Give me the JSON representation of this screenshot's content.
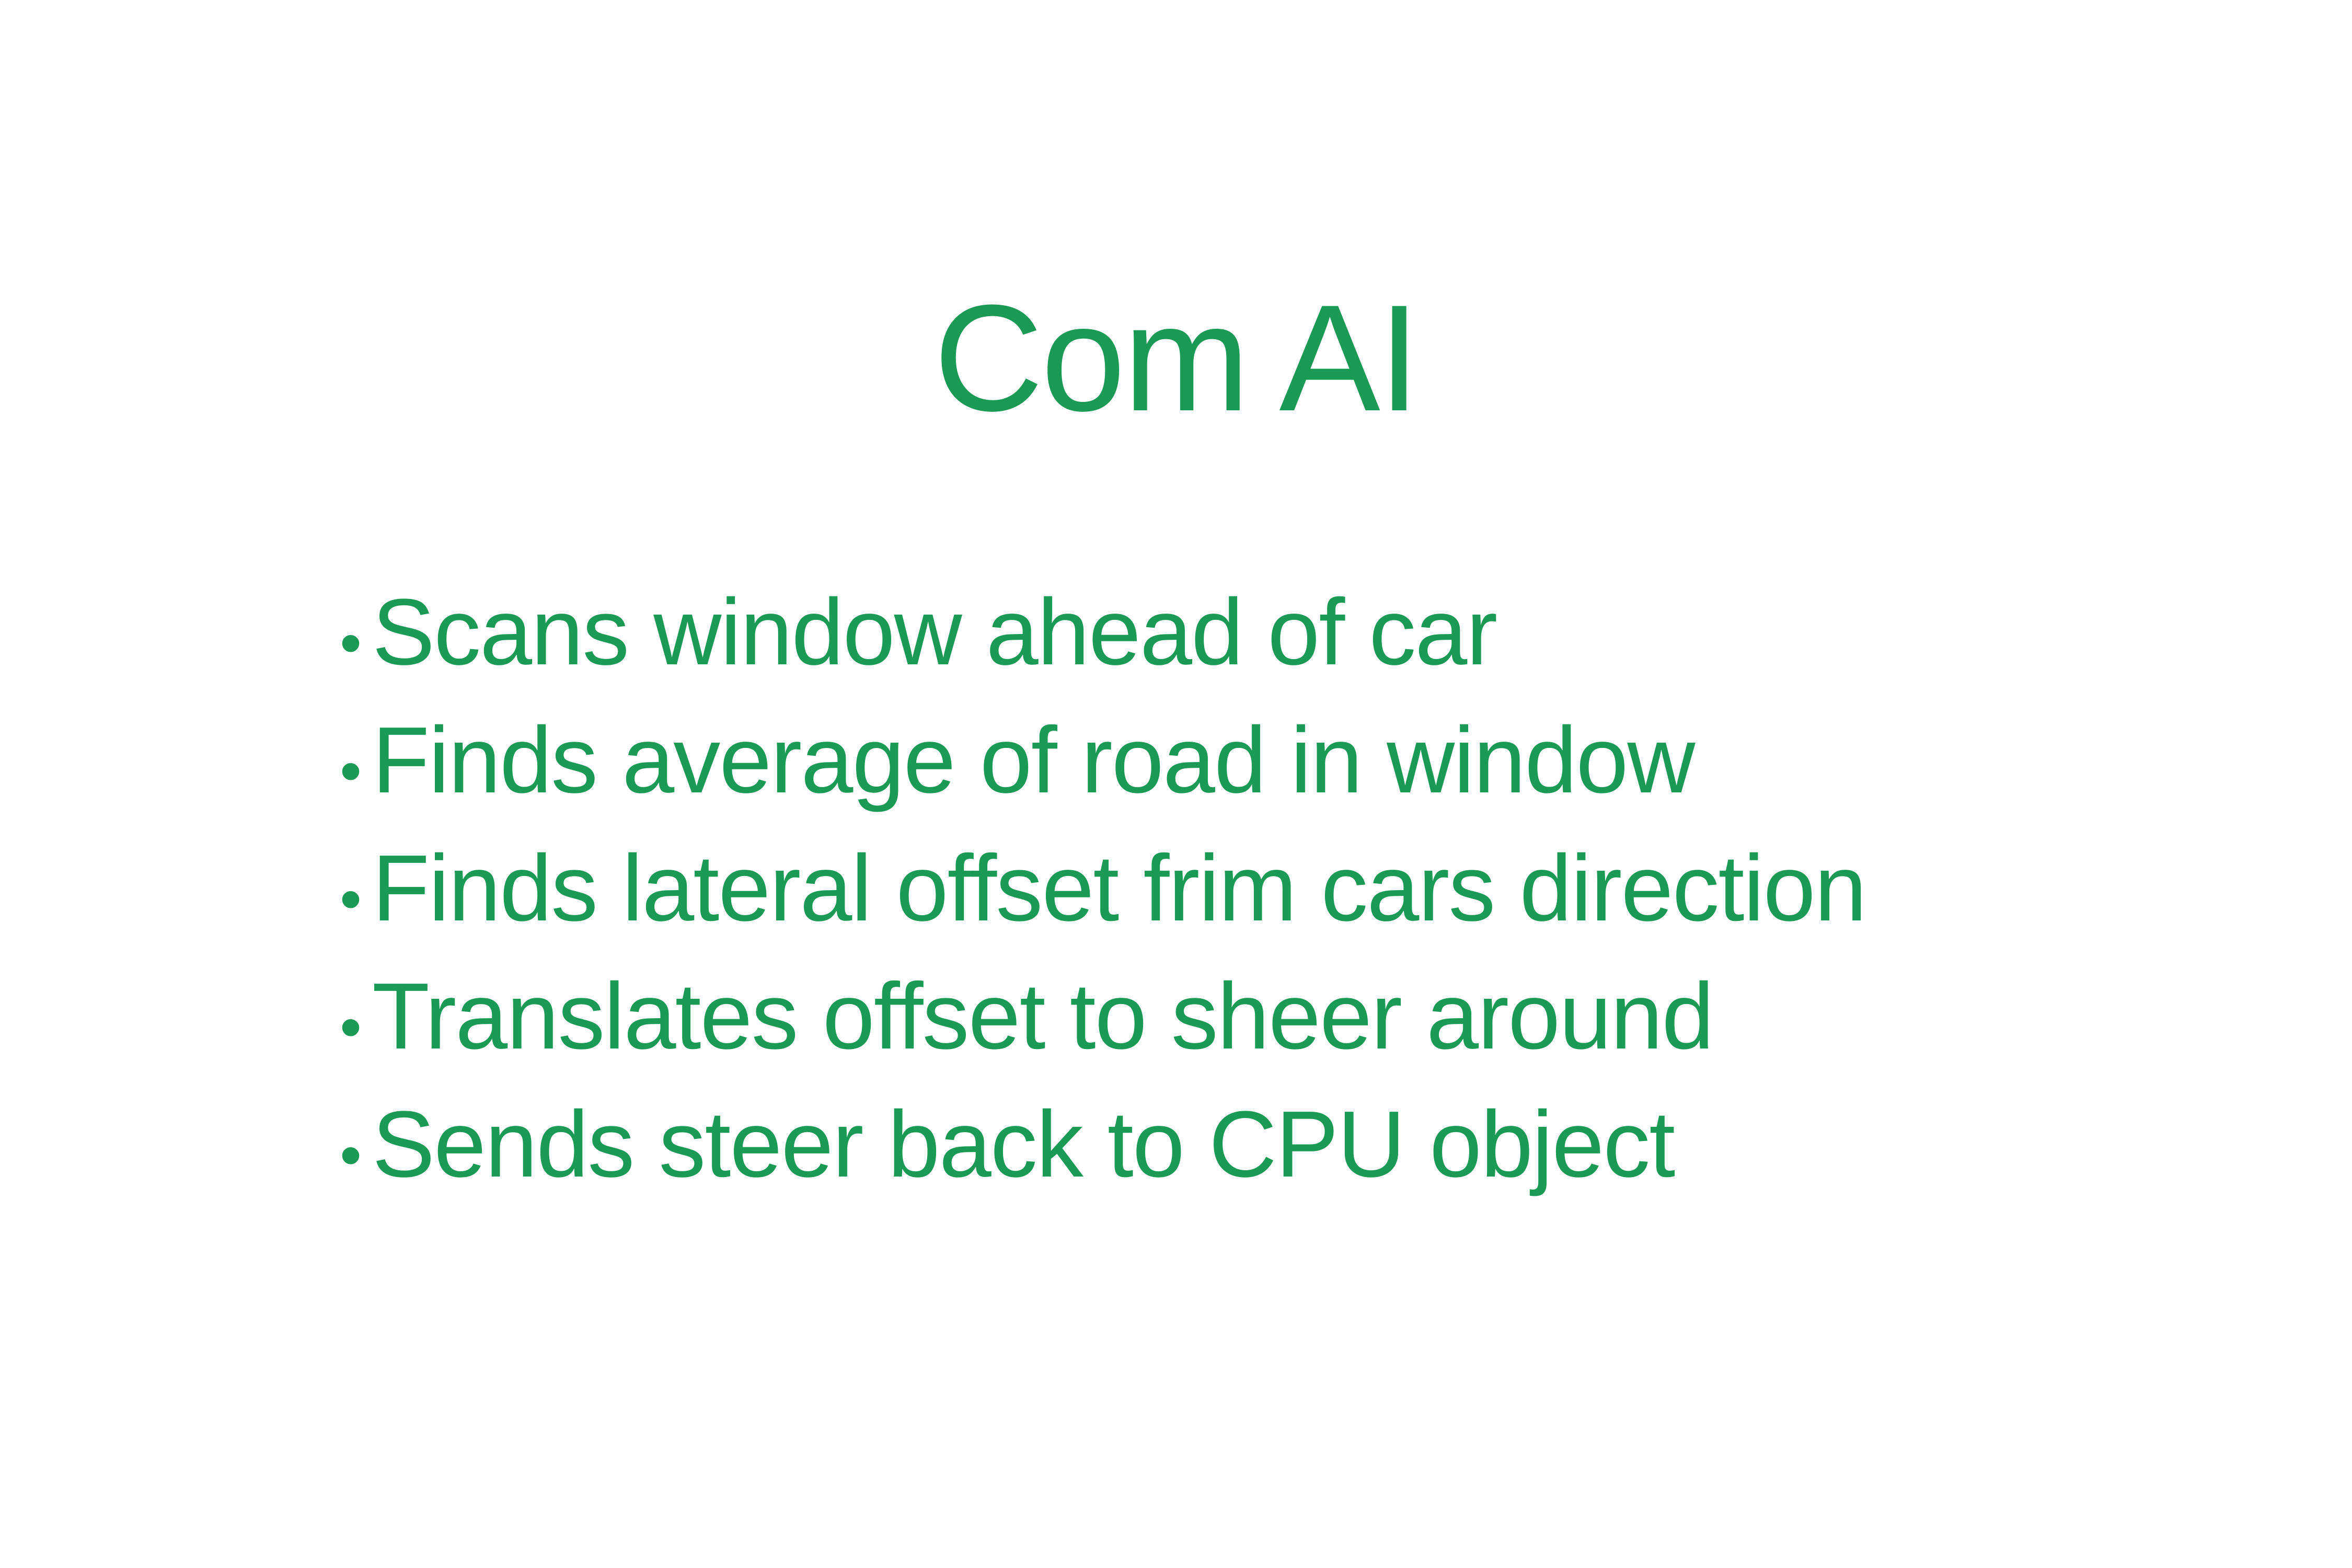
{
  "slide": {
    "title": "Com AI",
    "bullet_char": "•",
    "bullets": [
      "Scans window ahead of car",
      "Finds average of road in window",
      "Finds lateral offset frim cars direction",
      "Translates offset to sheer around",
      "Sends steer back to CPU object"
    ],
    "text_color": "#1b9a55",
    "background_color": "#ffffff"
  }
}
